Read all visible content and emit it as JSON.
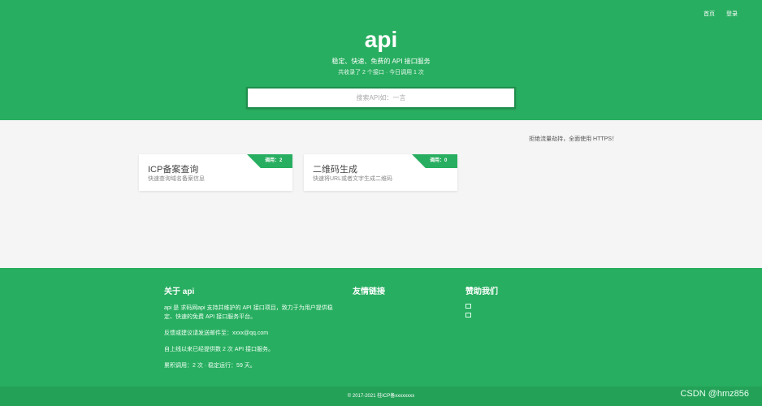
{
  "nav": {
    "home": "首页",
    "login": "登录"
  },
  "hero": {
    "title": "api",
    "subtitle": "稳定、快速、免费的 API 接口服务",
    "stats": "共收录了 2 个接口 · 今日调用 1 次",
    "search_placeholder": "搜索API如：一言"
  },
  "notice": "拒绝流量劫持，全面使用 HTTPS！",
  "cards": [
    {
      "title": "ICP备案查询",
      "desc": "快速查询域名备案信息",
      "badge": "调用：2"
    },
    {
      "title": "二维码生成",
      "desc": "快速将URL或者文字生成二维码",
      "badge": "调用：0"
    }
  ],
  "footer": {
    "about_title": "关于 api",
    "about_text": "api 是 求码网api 支持并维护的 API 接口项目，致力于为用户提供稳定、快速的免费 API 接口服务平台。",
    "contact_text": "反馈或建议请发送邮件至：xxxx@qq.com",
    "served_text": "自上线以来已经提供数 2 次 API 接口服务。",
    "running_text": "累积调用：2 次 · 稳定运行：59 天。",
    "links_title": "友情链接",
    "sponsor_title": "赞助我们"
  },
  "copyright": "© 2017-2021    桂ICP备xxxxxxxx",
  "watermark": "CSDN @hmz856",
  "colors": {
    "primary": "#28ae60",
    "page_bg": "#f5f5f5"
  }
}
